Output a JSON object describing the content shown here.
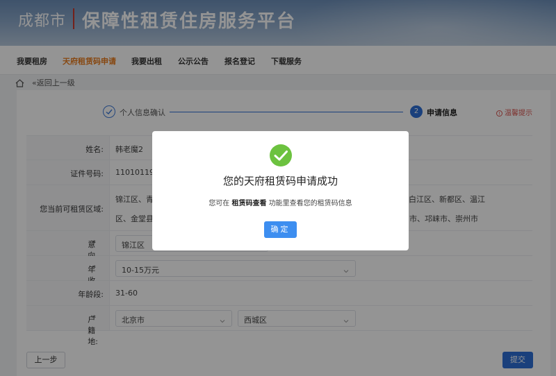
{
  "header": {
    "city": "成都市",
    "platform_title": "保障性租赁住房服务平台"
  },
  "nav": {
    "items": [
      {
        "label": "我要租房",
        "active": false
      },
      {
        "label": "天府租赁码申请",
        "active": true
      },
      {
        "label": "我要出租",
        "active": false
      },
      {
        "label": "公示公告",
        "active": false
      },
      {
        "label": "报名登记",
        "active": false
      },
      {
        "label": "下载服务",
        "active": false
      }
    ]
  },
  "breadcrumb": {
    "back_label": "«返回上一级"
  },
  "steps": {
    "step1_label": "个人信息确认",
    "step2_number": "2",
    "step2_label": "申请信息"
  },
  "tip": {
    "label": "温馨提示"
  },
  "form": {
    "name_label": "姓名:",
    "name_value": "韩老魔2",
    "id_label": "证件号码:",
    "id_value": "110101195",
    "area_label": "您当前可租赁区域:",
    "area_line1_left": "锦江区、青",
    "area_line1_right": "白江区、新都区、温江",
    "area_line2_left": "区、金堂县",
    "area_line2_right": "州市、邛崃市、崇州市",
    "intent_label": "意向租赁区域:",
    "intent_value": "锦江区",
    "income_label": "年收入:",
    "income_value": "10-15万元",
    "age_label": "年龄段:",
    "age_value": "31-60",
    "hukou_label": "户籍地:",
    "hukou_city": "北京市",
    "hukou_district": "西城区"
  },
  "buttons": {
    "prev": "上一步",
    "submit": "提交"
  },
  "modal": {
    "title": "您的天府租赁码申请成功",
    "msg_prefix": "您可在",
    "msg_link": "租赁码查看",
    "msg_suffix": "功能里查看您的租赁码信息",
    "ok_label": "确定"
  },
  "colors": {
    "accent_orange": "#e87b1c",
    "primary_blue": "#2d6fd6",
    "success_green": "#6cc23f",
    "required_red": "#e0483e"
  }
}
